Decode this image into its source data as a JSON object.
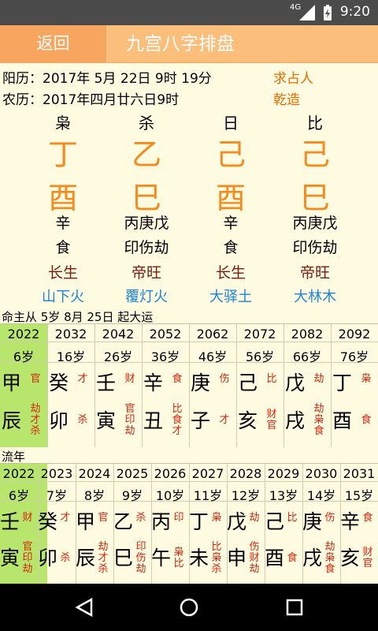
{
  "status": {
    "network": "4G",
    "time": "9:20"
  },
  "header": {
    "back_label": "返回",
    "title": "九宫八字排盘"
  },
  "info": {
    "solar": "阳历：2017年  5月 22日 9时 19分",
    "lunar": "农历：2017年四月廿六日9时",
    "asker": "求占人",
    "gender": "乾造"
  },
  "pillars": [
    {
      "god": "枭",
      "stem": "丁",
      "branch": "酉",
      "hidden": "辛",
      "hgods": "食",
      "stage": "长生",
      "nayin": "山下火"
    },
    {
      "god": "杀",
      "stem": "乙",
      "branch": "巳",
      "hidden": "丙庚戊",
      "hgods": "印伤劫",
      "stage": "帝旺",
      "nayin": "覆灯火"
    },
    {
      "god": "日",
      "stem": "己",
      "branch": "酉",
      "hidden": "辛",
      "hgods": "食",
      "stage": "长生",
      "nayin": "大驿土"
    },
    {
      "god": "比",
      "stem": "己",
      "branch": "巳",
      "hidden": "丙庚戊",
      "hgods": "印伤劫",
      "stage": "帝旺",
      "nayin": "大林木"
    }
  ],
  "dayun_note": "命主从 5岁 8月 25日  起大运",
  "dayun": [
    {
      "year": "2022",
      "age": "6岁",
      "stem": "甲",
      "sg": "官",
      "branch": "辰",
      "bg": "劫\n才\n杀"
    },
    {
      "year": "2032",
      "age": "16岁",
      "stem": "癸",
      "sg": "才",
      "branch": "卯",
      "bg": "杀"
    },
    {
      "year": "2042",
      "age": "26岁",
      "stem": "壬",
      "sg": "财",
      "branch": "寅",
      "bg": "官\n印\n劫"
    },
    {
      "year": "2052",
      "age": "36岁",
      "stem": "辛",
      "sg": "食",
      "branch": "丑",
      "bg": "比\n食\n才"
    },
    {
      "year": "2062",
      "age": "46岁",
      "stem": "庚",
      "sg": "伤",
      "branch": "子",
      "bg": "才"
    },
    {
      "year": "2072",
      "age": "56岁",
      "stem": "己",
      "sg": "比",
      "branch": "亥",
      "bg": "财\n官"
    },
    {
      "year": "2082",
      "age": "66岁",
      "stem": "戊",
      "sg": "劫",
      "branch": "戌",
      "bg": "劫\n枭\n食"
    },
    {
      "year": "2092",
      "age": "76岁",
      "stem": "丁",
      "sg": "枭",
      "branch": "酉",
      "bg": "食"
    }
  ],
  "liunian_label": "流年",
  "liunian": [
    {
      "year": "2022",
      "age": "6岁",
      "stem": "壬",
      "sg": "财",
      "branch": "寅",
      "bg": "官\n印\n劫"
    },
    {
      "year": "2023",
      "age": "7岁",
      "stem": "癸",
      "sg": "才",
      "branch": "卯",
      "bg": "杀"
    },
    {
      "year": "2024",
      "age": "8岁",
      "stem": "甲",
      "sg": "官",
      "branch": "辰",
      "bg": "劫\n才\n杀"
    },
    {
      "year": "2025",
      "age": "9岁",
      "stem": "乙",
      "sg": "杀",
      "branch": "巳",
      "bg": "印\n伤\n劫"
    },
    {
      "year": "2026",
      "age": "10岁",
      "stem": "丙",
      "sg": "印",
      "branch": "午",
      "bg": "枭\n比"
    },
    {
      "year": "2027",
      "age": "11岁",
      "stem": "丁",
      "sg": "枭",
      "branch": "未",
      "bg": "比\n枭\n杀"
    },
    {
      "year": "2028",
      "age": "12岁",
      "stem": "戊",
      "sg": "劫",
      "branch": "申",
      "bg": "伤\n财\n劫"
    },
    {
      "year": "2029",
      "age": "13岁",
      "stem": "己",
      "sg": "比",
      "branch": "酉",
      "bg": "食"
    },
    {
      "year": "2030",
      "age": "14岁",
      "stem": "庚",
      "sg": "伤",
      "branch": "戌",
      "bg": "劫\n枭\n食"
    },
    {
      "year": "2031",
      "age": "15岁",
      "stem": "辛",
      "sg": "食",
      "branch": "亥",
      "bg": "财\n官"
    }
  ]
}
